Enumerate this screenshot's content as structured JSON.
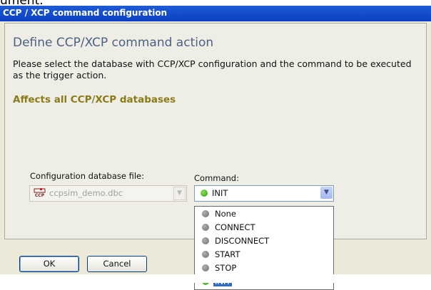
{
  "cropped_text": "ument.",
  "window": {
    "title": "CCP / XCP command configuration"
  },
  "content": {
    "heading": "Define CCP/XCP command action",
    "description": "Please select the database with CCP/XCP configuration and the command to be executed as the trigger action.",
    "affects": "Affects all CCP/XCP databases"
  },
  "database": {
    "label": "Configuration database file:",
    "value": "ccpsim_demo.dbc",
    "icon": "ccp-database-icon",
    "icon_text": "CCP"
  },
  "command": {
    "label": "Command:",
    "value": "INIT",
    "options": [
      {
        "label": "None",
        "status": "grey"
      },
      {
        "label": "CONNECT",
        "status": "grey"
      },
      {
        "label": "DISCONNECT",
        "status": "grey"
      },
      {
        "label": "START",
        "status": "grey"
      },
      {
        "label": "STOP",
        "status": "grey"
      },
      {
        "label": "INIT",
        "status": "green"
      }
    ]
  },
  "buttons": {
    "ok": "OK",
    "cancel": "Cancel"
  },
  "colors": {
    "titlebar": "#0a3fc2",
    "heading": "#4d6184",
    "affects": "#8a7a1a",
    "selection": "#316ac5"
  }
}
